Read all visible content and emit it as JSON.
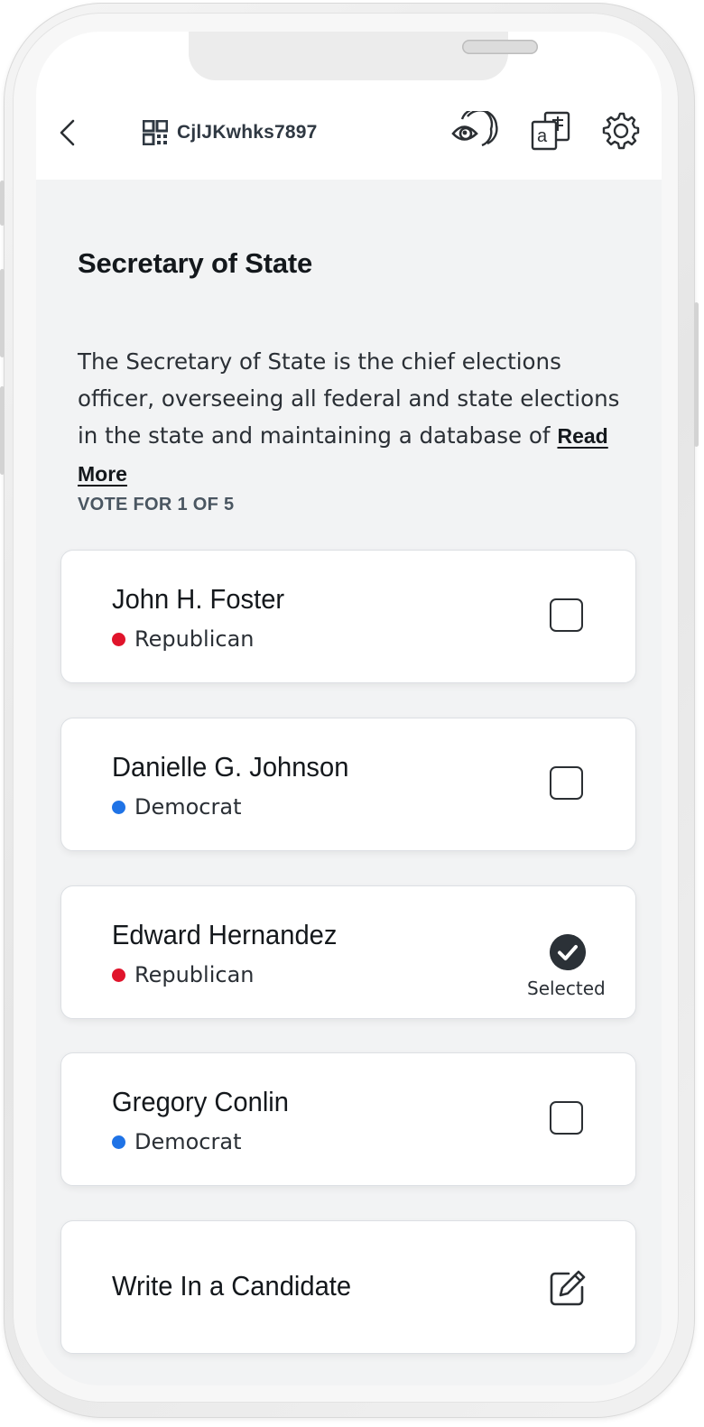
{
  "header": {
    "ballot_id": "CjlJKwhks7897",
    "back_icon": "chevron-left-icon",
    "qr_icon": "qr-code-icon",
    "eye_icon": "visibility-icon",
    "translate_icon": "translate-icon",
    "settings_icon": "gear-icon"
  },
  "contest": {
    "title": "Secretary of State",
    "description": "The Secretary of State is the chief elections officer, overseeing all federal and state elections in the state and maintaining a database of",
    "read_more": "Read More",
    "vote_for": "VOTE FOR 1 OF 5"
  },
  "candidates": [
    {
      "name": "John H. Foster",
      "party": "Republican",
      "party_color": "#e0142b",
      "selected": false
    },
    {
      "name": "Danielle G. Johnson",
      "party": "Democrat",
      "party_color": "#1f73e6",
      "selected": false
    },
    {
      "name": "Edward Hernandez",
      "party": "Republican",
      "party_color": "#e0142b",
      "selected": true,
      "selected_label": "Selected"
    },
    {
      "name": "Gregory Conlin",
      "party": "Democrat",
      "party_color": "#1f73e6",
      "selected": false
    }
  ],
  "write_in": {
    "label": "Write In a Candidate",
    "icon": "edit-icon"
  }
}
